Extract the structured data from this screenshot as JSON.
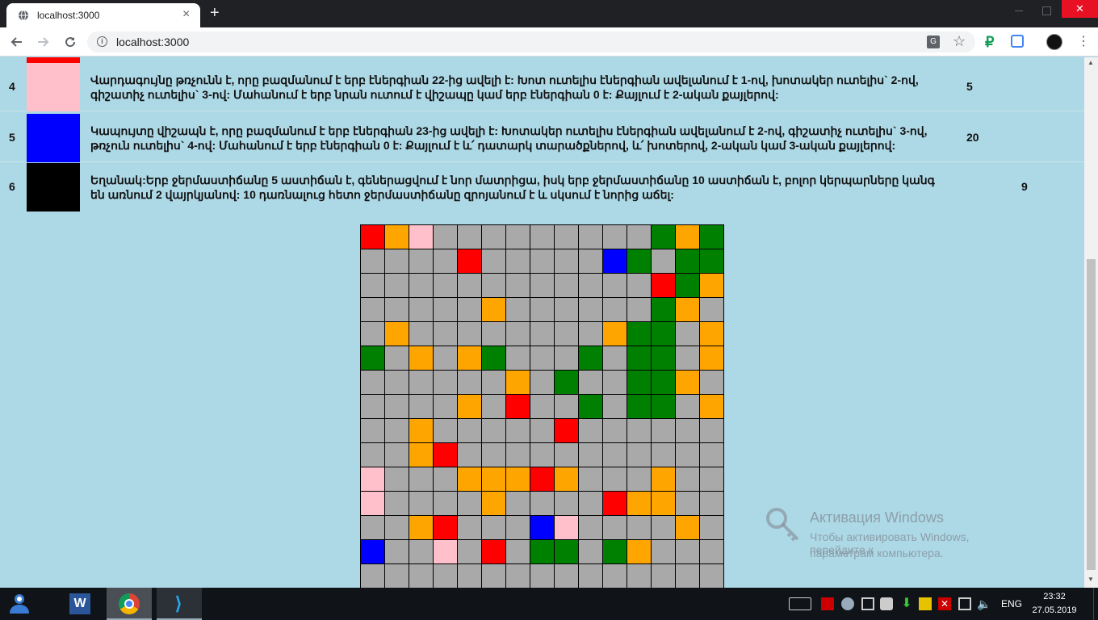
{
  "browser": {
    "tab_title": "localhost:3000",
    "new_tab_label": "+",
    "close_tab_label": "×",
    "url": "localhost:3000",
    "close_window_label": "✕"
  },
  "legend_rows": [
    {
      "number": "4",
      "color": "#ffc0cb",
      "description": "Վարդագույնը թռչունն է, որը բազմանում է երբ էներգիան 22-ից ավելի է: Խոտ ուտելիս էներգիան ավելանում է 1-ով, խոտակեր ուտելիս` 2-ով, գիշատիչ ուտելիս` 3-ով: Մահանում է երբ նրան ուտում է վիշապը կամ երբ էներգիան 0 է: Քայլում է 2-ական քայլերով:",
      "value": "5"
    },
    {
      "number": "5",
      "color": "#0000ff",
      "description": "Կապույտը վիշապն է, որը բազմանում է երբ էներգիան 23-ից ավելի է: Խոտակեր ուտելիս էներգիան ավելանում է 2-ով, գիշատիչ ուտելիս` 3-ով, թռչուն ուտելիս` 4-ով: Մահանում է երբ էներգիան 0 է: Քայլում է և՛ դատարկ տարածքներով, և՛ խոտերով, 2-ական կամ 3-ական քայլերով:",
      "value": "20"
    },
    {
      "number": "6",
      "color": "#000000",
      "description": "Եղանակ:Երբ ջերմաստիճանը 5 աստիճան է, գեներացվում է նոր մատրիցա, իսկ երբ ջերմաստիճանը 10 աստիճան է, բոլոր կերպարները կանգ են առնում 2 վայրկյանով: 10 դառնալուց հետո ջերմաստիճանը զրոյանում է և սկսում է նորից աճել:",
      "value": "9"
    }
  ],
  "grid": {
    "palette": {
      "0": "#a9a9a9",
      "1": "#008000",
      "2": "#ffa500",
      "3": "#ff0000",
      "4": "#ffc0cb",
      "5": "#0000ff"
    },
    "rows": [
      [
        3,
        2,
        4,
        0,
        0,
        0,
        0,
        0,
        0,
        0,
        0,
        0,
        1,
        2,
        1
      ],
      [
        0,
        0,
        0,
        0,
        3,
        0,
        0,
        0,
        0,
        0,
        5,
        1,
        0,
        1,
        1
      ],
      [
        0,
        0,
        0,
        0,
        0,
        0,
        0,
        0,
        0,
        0,
        0,
        0,
        3,
        1,
        2
      ],
      [
        0,
        0,
        0,
        0,
        0,
        2,
        0,
        0,
        0,
        0,
        0,
        0,
        1,
        2,
        0
      ],
      [
        0,
        2,
        0,
        0,
        0,
        0,
        0,
        0,
        0,
        0,
        2,
        1,
        1,
        0,
        2
      ],
      [
        1,
        0,
        2,
        0,
        2,
        1,
        0,
        0,
        0,
        1,
        0,
        1,
        1,
        0,
        2
      ],
      [
        0,
        0,
        0,
        0,
        0,
        0,
        2,
        0,
        1,
        0,
        0,
        1,
        1,
        2,
        0
      ],
      [
        0,
        0,
        0,
        0,
        2,
        0,
        3,
        0,
        0,
        1,
        0,
        1,
        1,
        0,
        2
      ],
      [
        0,
        0,
        2,
        0,
        0,
        0,
        0,
        0,
        3,
        0,
        0,
        0,
        0,
        0,
        0
      ],
      [
        0,
        0,
        2,
        3,
        0,
        0,
        0,
        0,
        0,
        0,
        0,
        0,
        0,
        0,
        0
      ],
      [
        4,
        0,
        0,
        0,
        2,
        2,
        2,
        3,
        2,
        0,
        0,
        0,
        2,
        0,
        0
      ],
      [
        4,
        0,
        0,
        0,
        0,
        2,
        0,
        0,
        0,
        0,
        3,
        2,
        2,
        0,
        0
      ],
      [
        0,
        0,
        2,
        3,
        0,
        0,
        0,
        5,
        4,
        0,
        0,
        0,
        0,
        2,
        0
      ],
      [
        5,
        0,
        0,
        4,
        0,
        3,
        0,
        1,
        1,
        0,
        1,
        2,
        0,
        0,
        0
      ],
      [
        0,
        0,
        0,
        0,
        0,
        0,
        0,
        0,
        0,
        0,
        0,
        0,
        0,
        0,
        0
      ]
    ]
  },
  "watermark": {
    "title": "Активация Windows",
    "line1": "Чтобы активировать Windows, перейдите к",
    "line2": "параметрам компьютера."
  },
  "taskbar": {
    "word_letter": "W",
    "vscode_glyph": "⟩",
    "language": "ENG",
    "time": "23:32",
    "date": "27.05.2019"
  }
}
